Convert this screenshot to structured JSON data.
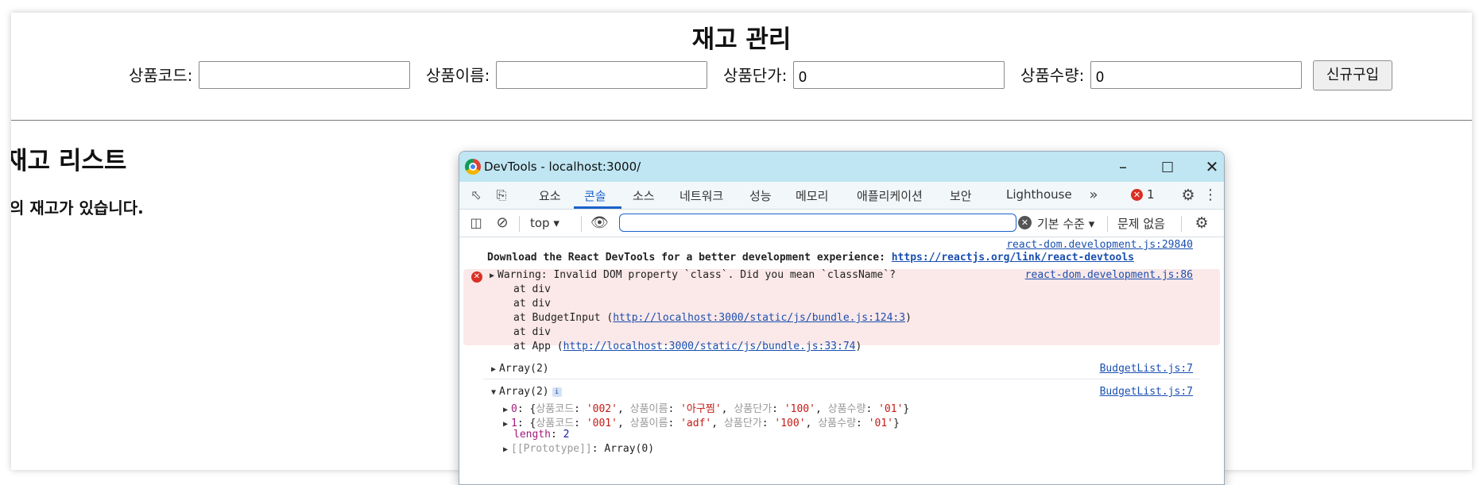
{
  "app": {
    "title": "재고 관리",
    "form": {
      "code_label": "상품코드:",
      "code_value": "",
      "name_label": "상품이름:",
      "name_value": "",
      "price_label": "상품단가:",
      "price_value": "0",
      "qty_label": "상품수량:",
      "qty_value": "0",
      "buy_button": "신규구입"
    },
    "list_title": "재고 리스트",
    "list_status": "의 재고가 있습니다."
  },
  "devtools": {
    "window_title": "DevTools - localhost:3000/",
    "tabs": [
      "요소",
      "콘솔",
      "소스",
      "네트워크",
      "성능",
      "메모리",
      "애플리케이션",
      "보안",
      "Lighthouse"
    ],
    "active_tab": "콘솔",
    "error_count": "1",
    "context": "top",
    "filter_value": "",
    "levels": "기본 수준",
    "issues": "문제 없음",
    "console": {
      "devtools_src": "react-dom.development.js:29840",
      "devtools_msg": "Download the React DevTools for a better development experience: ",
      "devtools_link": "https://reactjs.org/link/react-devtools",
      "warn_src": "react-dom.development.js:86",
      "warn_msg": "Warning: Invalid DOM property `class`. Did you mean `className`?",
      "stack_1": "at div",
      "stack_2": "at div",
      "stack_3_prefix": "at BudgetInput (",
      "stack_3_link": "http://localhost:3000/static/js/bundle.js:124:3",
      "stack_3_suffix": ")",
      "stack_4": "at div",
      "stack_5_prefix": "at App (",
      "stack_5_link": "http://localhost:3000/static/js/bundle.js:33:74",
      "stack_5_suffix": ")",
      "array1_label": "Array(2)",
      "array1_src": "BudgetList.js:7",
      "array2_label": "Array(2)",
      "array2_src": "BudgetList.js:7",
      "item0_index": "0",
      "item0": {
        "code": "'002'",
        "name": "'아구찜'",
        "price": "'100'",
        "qty": "'01'"
      },
      "item1_index": "1",
      "item1": {
        "code": "'001'",
        "name": "'adf'",
        "price": "'100'",
        "qty": "'01'"
      },
      "keys": {
        "code": "상품코드",
        "name": "상품이름",
        "price": "상품단가",
        "qty": "상품수량"
      },
      "length_key": "length",
      "length_value": "2",
      "proto_key": "[[Prototype]]",
      "proto_value": "Array(0)"
    }
  }
}
